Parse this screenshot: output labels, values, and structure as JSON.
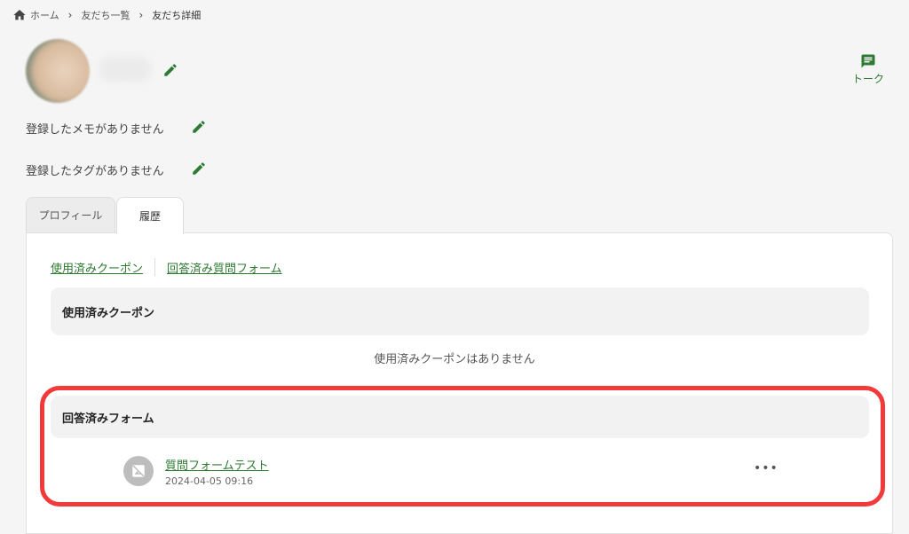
{
  "breadcrumb": {
    "home": "ホーム",
    "friends_list": "友だち一覧",
    "current": "友だち詳細"
  },
  "actions": {
    "talk_label": "トーク"
  },
  "profile": {
    "memo_empty": "登録したメモがありません",
    "tag_empty": "登録したタグがありません"
  },
  "tabs": [
    {
      "label": "プロフィール",
      "active": false
    },
    {
      "label": "履歴",
      "active": true
    }
  ],
  "history": {
    "sublinks": [
      "使用済みクーポン",
      "回答済み質問フォーム"
    ],
    "coupons": {
      "heading": "使用済みクーポン",
      "empty_message": "使用済みクーポンはありません"
    },
    "forms": {
      "heading": "回答済みフォーム",
      "items": [
        {
          "title": "質問フォームテスト",
          "date": "2024-04-05 09:16",
          "icon": "image-off-icon",
          "menu": "•••"
        }
      ]
    }
  },
  "colors": {
    "accent_green": "#2d7a32",
    "highlight_red": "#f23a3a",
    "background": "#f5f5f5"
  }
}
